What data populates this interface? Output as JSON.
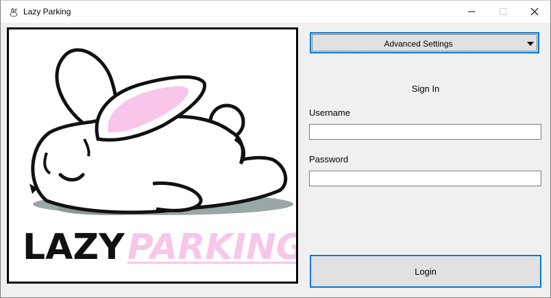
{
  "window": {
    "title": "Lazy Parking",
    "icon": "rabbit-app-icon",
    "controls": [
      "minimize",
      "maximize",
      "close"
    ]
  },
  "logo": {
    "word1": "LAZY",
    "word2": "PARKING",
    "image": "sleeping-rabbit-illustration",
    "colors": {
      "lazy": "#111111",
      "parking": "#f6c7e9",
      "ear": "#f7c6ea"
    }
  },
  "settings": {
    "dropdown_label": "Advanced Settings",
    "accent": "#0078d7"
  },
  "form": {
    "heading": "Sign In",
    "username_label": "Username",
    "username_value": "",
    "password_label": "Password",
    "password_value": "",
    "login_label": "Login"
  }
}
